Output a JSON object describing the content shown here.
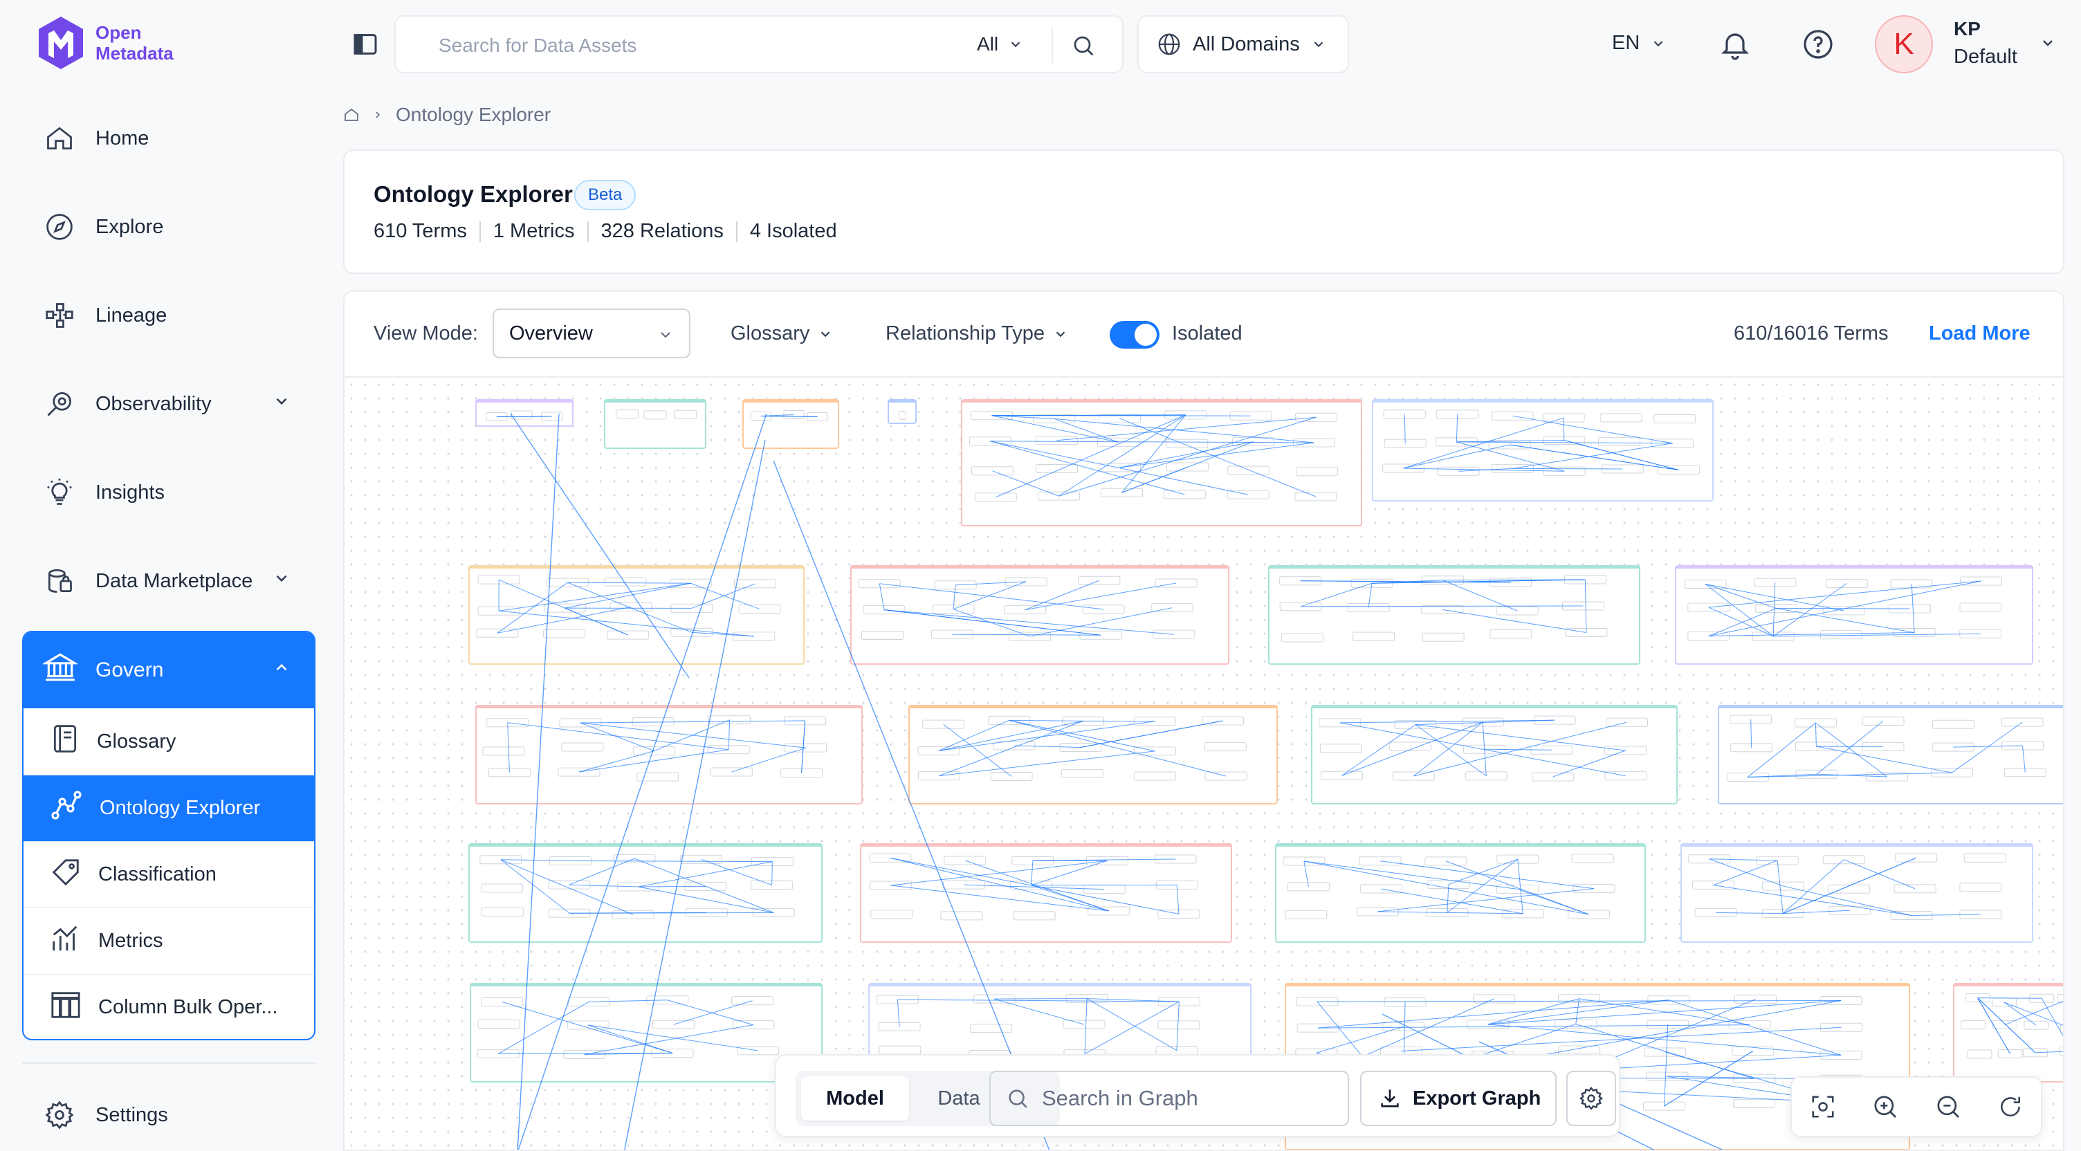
{
  "app": {
    "name_line1": "Open",
    "name_line2": "Metadata"
  },
  "nav": {
    "home": "Home",
    "explore": "Explore",
    "lineage": "Lineage",
    "observability": "Observability",
    "insights": "Insights",
    "marketplace": "Data Marketplace",
    "govern": "Govern",
    "settings": "Settings",
    "govern_items": [
      "Glossary",
      "Ontology Explorer",
      "Classification",
      "Metrics",
      "Column Bulk Oper..."
    ]
  },
  "topbar": {
    "search_placeholder": "Search for Data Assets",
    "search_filter": "All",
    "domain": "All Domains",
    "language": "EN",
    "user_initial": "K",
    "user_name": "KP",
    "user_role": "Default"
  },
  "breadcrumb": {
    "current": "Ontology Explorer"
  },
  "header": {
    "title": "Ontology Explorer",
    "badge": "Beta",
    "terms": "610 Terms",
    "metrics": "1 Metrics",
    "relations": "328 Relations",
    "isolated": "4 Isolated"
  },
  "toolbar": {
    "view_mode_label": "View Mode:",
    "view_mode_value": "Overview",
    "glossary": "Glossary",
    "relationship_type": "Relationship Type",
    "isolated_toggle_on": true,
    "isolated_label": "Isolated",
    "count": "610/16016 Terms",
    "load_more": "Load More"
  },
  "graph_controls": {
    "mode_model": "Model",
    "mode_data": "Data",
    "search_placeholder": "Search in Graph",
    "export": "Export Graph"
  },
  "colors": {
    "primary": "#1677ff",
    "brand": "#7147e8",
    "edge": "#1677ff"
  }
}
